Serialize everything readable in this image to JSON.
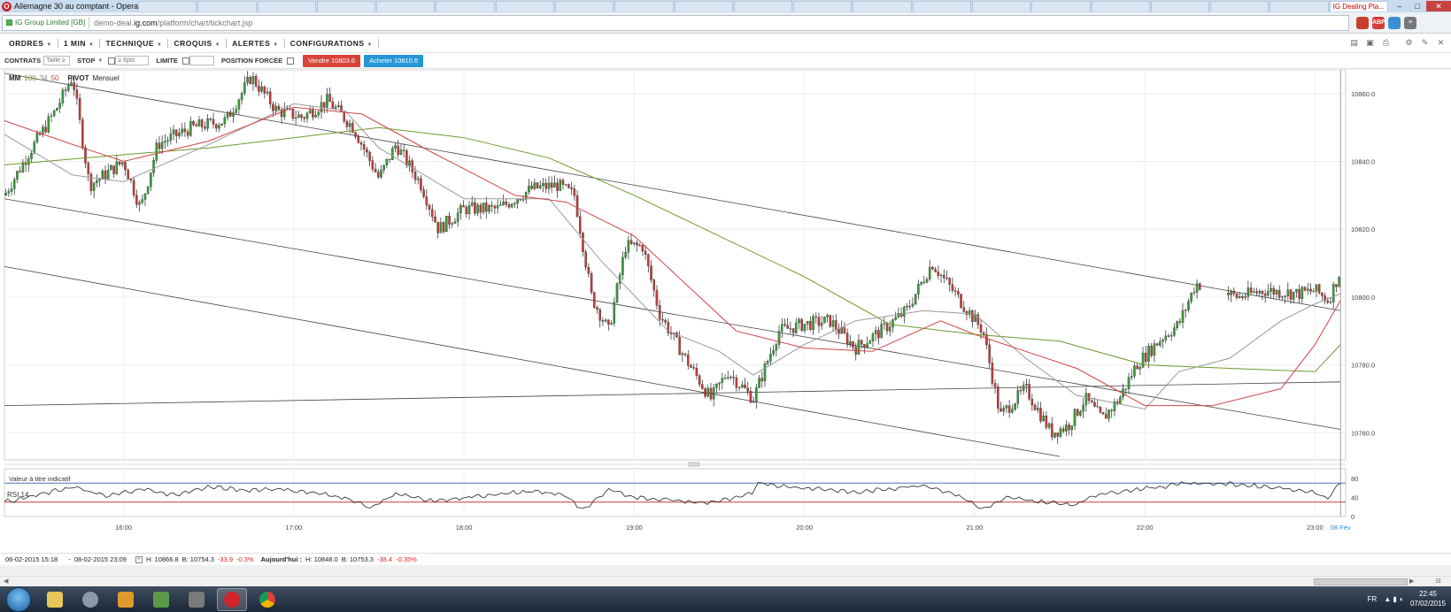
{
  "window": {
    "title": "Allemagne 30 au comptant - Opera",
    "tabs": [
      "",
      "",
      "",
      "",
      "",
      "",
      "",
      "",
      "",
      "",
      "",
      "",
      "",
      "",
      "",
      "",
      "",
      "",
      "",
      "",
      "IG Dealing Pla..."
    ],
    "controls": {
      "minimize": "–",
      "maximize": "□",
      "close": "✕"
    }
  },
  "address": {
    "security_label": "IG Group Limited [GB]",
    "url_prefix": "demo-deal.",
    "url_domain": "ig.com",
    "url_path": "/platform/chart/tickchart.jsp"
  },
  "menu": {
    "items": [
      "ORDRES",
      "1 MIN",
      "TECHNIQUE",
      "CROQUIS",
      "ALERTES",
      "CONFIGURATIONS"
    ]
  },
  "deal_bar": {
    "contracts_label": "CONTRATS",
    "size_placeholder": "Taille ≥ 1",
    "stop_label": "STOP",
    "stop_placeholder": "≥ 6pts",
    "limit_label": "LIMITE",
    "forced_label": "POSITION FORCÉE",
    "sell_label": "Vendre 10803.6",
    "buy_label": "Acheter 10810.6"
  },
  "legend": {
    "mm_label": "MM",
    "mm1": "100",
    "mm2": "34",
    "mm3": "50",
    "pivot_label": "PIVOT",
    "pivot_period": "Mensuel"
  },
  "disclaimer": "Valeur à titre indicatif",
  "rsi_label": "RSI  14",
  "chart_data": {
    "type": "candlestick",
    "title": "",
    "x_ticks": [
      "16:00",
      "17:00",
      "18:00",
      "19:00",
      "20:00",
      "21:00",
      "22:00",
      "23:00",
      "08 Fév"
    ],
    "x_range": [
      "15:18",
      "23:09"
    ],
    "price_ticks": [
      10860,
      10840,
      10820,
      10800,
      10780,
      10760
    ],
    "price_tick_labels": [
      "10860.0",
      "10840.0",
      "10820.0",
      "10800.0",
      "10780.0",
      "10760.0"
    ],
    "price_range": [
      10752,
      10867
    ],
    "rsi_ticks": [
      80,
      40,
      0
    ],
    "rsi_levels": {
      "upper": 70,
      "lower": 30
    },
    "rsi_range": [
      0,
      100
    ],
    "series": [
      {
        "name": "MM 100",
        "color": "#6d9a2c",
        "points": [
          [
            15.3,
            10839
          ],
          [
            16.0,
            10842
          ],
          [
            16.5,
            10844
          ],
          [
            17.0,
            10847
          ],
          [
            17.5,
            10850
          ],
          [
            18.0,
            10847
          ],
          [
            18.5,
            10841
          ],
          [
            19.0,
            10830
          ],
          [
            19.5,
            10818
          ],
          [
            20.0,
            10806
          ],
          [
            20.5,
            10792
          ],
          [
            21.0,
            10789
          ],
          [
            21.5,
            10787
          ],
          [
            22.0,
            10780
          ],
          [
            22.5,
            10779
          ],
          [
            23.0,
            10778
          ],
          [
            23.15,
            10786
          ]
        ]
      },
      {
        "name": "MM 34",
        "color": "#999999",
        "points": [
          [
            15.3,
            10848
          ],
          [
            15.7,
            10836
          ],
          [
            16.0,
            10834
          ],
          [
            16.5,
            10845
          ],
          [
            17.0,
            10857
          ],
          [
            17.3,
            10855
          ],
          [
            17.5,
            10844
          ],
          [
            18.0,
            10829
          ],
          [
            18.5,
            10829
          ],
          [
            18.8,
            10811
          ],
          [
            19.2,
            10790
          ],
          [
            19.5,
            10784
          ],
          [
            19.7,
            10777
          ],
          [
            20.0,
            10786
          ],
          [
            20.3,
            10793
          ],
          [
            20.7,
            10796
          ],
          [
            21.0,
            10795
          ],
          [
            21.3,
            10782
          ],
          [
            21.6,
            10771
          ],
          [
            22.0,
            10767
          ],
          [
            22.2,
            10778
          ],
          [
            22.5,
            10782
          ],
          [
            22.8,
            10793
          ],
          [
            23.0,
            10798
          ],
          [
            23.15,
            10801
          ]
        ]
      },
      {
        "name": "MM 50",
        "color": "#d04545",
        "points": [
          [
            15.3,
            10852
          ],
          [
            15.7,
            10845
          ],
          [
            16.0,
            10840
          ],
          [
            16.5,
            10846
          ],
          [
            17.0,
            10856
          ],
          [
            17.4,
            10854
          ],
          [
            17.8,
            10843
          ],
          [
            18.3,
            10830
          ],
          [
            18.6,
            10828
          ],
          [
            19.0,
            10818
          ],
          [
            19.3,
            10804
          ],
          [
            19.6,
            10790
          ],
          [
            20.0,
            10785
          ],
          [
            20.4,
            10784
          ],
          [
            20.8,
            10793
          ],
          [
            21.0,
            10789
          ],
          [
            21.3,
            10784
          ],
          [
            21.6,
            10779
          ],
          [
            22.0,
            10768
          ],
          [
            22.4,
            10768
          ],
          [
            22.8,
            10773
          ],
          [
            23.0,
            10786
          ],
          [
            23.15,
            10799
          ]
        ]
      }
    ],
    "trendlines": [
      {
        "from": [
          15.3,
          10866
        ],
        "to": [
          23.15,
          10796
        ]
      },
      {
        "from": [
          15.3,
          10829
        ],
        "to": [
          23.15,
          10761
        ]
      },
      {
        "from": [
          15.3,
          10809
        ],
        "to": [
          21.5,
          10753
        ]
      },
      {
        "from": [
          15.3,
          10768
        ],
        "to": [
          23.15,
          10775
        ]
      }
    ],
    "close_path": [
      [
        15.3,
        10830
      ],
      [
        15.45,
        10843
      ],
      [
        15.6,
        10855
      ],
      [
        15.7,
        10865
      ],
      [
        15.8,
        10833
      ],
      [
        16.0,
        10840
      ],
      [
        16.1,
        10826
      ],
      [
        16.2,
        10845
      ],
      [
        16.4,
        10850
      ],
      [
        16.6,
        10852
      ],
      [
        16.75,
        10865
      ],
      [
        16.9,
        10855
      ],
      [
        17.05,
        10853
      ],
      [
        17.2,
        10858
      ],
      [
        17.35,
        10850
      ],
      [
        17.5,
        10835
      ],
      [
        17.6,
        10845
      ],
      [
        17.75,
        10833
      ],
      [
        17.85,
        10820
      ],
      [
        18.0,
        10826
      ],
      [
        18.2,
        10826
      ],
      [
        18.4,
        10832
      ],
      [
        18.55,
        10833
      ],
      [
        18.65,
        10830
      ],
      [
        18.75,
        10800
      ],
      [
        18.85,
        10790
      ],
      [
        18.95,
        10815
      ],
      [
        19.05,
        10815
      ],
      [
        19.15,
        10795
      ],
      [
        19.3,
        10782
      ],
      [
        19.45,
        10770
      ],
      [
        19.55,
        10778
      ],
      [
        19.7,
        10770
      ],
      [
        19.85,
        10790
      ],
      [
        20.0,
        10792
      ],
      [
        20.15,
        10793
      ],
      [
        20.3,
        10785
      ],
      [
        20.45,
        10790
      ],
      [
        20.6,
        10796
      ],
      [
        20.75,
        10810
      ],
      [
        20.9,
        10800
      ],
      [
        21.05,
        10790
      ],
      [
        21.15,
        10765
      ],
      [
        21.3,
        10773
      ],
      [
        21.45,
        10760
      ],
      [
        21.55,
        10762
      ],
      [
        21.65,
        10770
      ],
      [
        21.75,
        10764
      ],
      [
        21.85,
        10770
      ],
      [
        21.95,
        10780
      ],
      [
        22.1,
        10788
      ],
      [
        22.2,
        10792
      ],
      [
        22.3,
        10804
      ],
      [
        22.55,
        10800
      ],
      [
        22.7,
        10802
      ],
      [
        22.9,
        10801
      ],
      [
        23.0,
        10802
      ],
      [
        23.08,
        10799
      ],
      [
        23.15,
        10808
      ]
    ],
    "rsi_path": [
      [
        15.3,
        30
      ],
      [
        15.5,
        45
      ],
      [
        15.7,
        62
      ],
      [
        15.9,
        42
      ],
      [
        16.1,
        58
      ],
      [
        16.3,
        45
      ],
      [
        16.5,
        62
      ],
      [
        16.7,
        55
      ],
      [
        16.9,
        58
      ],
      [
        17.1,
        50
      ],
      [
        17.3,
        40
      ],
      [
        17.45,
        18
      ],
      [
        17.6,
        48
      ],
      [
        17.8,
        32
      ],
      [
        18.0,
        38
      ],
      [
        18.2,
        48
      ],
      [
        18.4,
        52
      ],
      [
        18.6,
        45
      ],
      [
        18.7,
        12
      ],
      [
        18.85,
        58
      ],
      [
        19.0,
        40
      ],
      [
        19.2,
        35
      ],
      [
        19.4,
        28
      ],
      [
        19.6,
        38
      ],
      [
        19.7,
        50
      ],
      [
        19.72,
        72
      ],
      [
        19.9,
        62
      ],
      [
        20.1,
        58
      ],
      [
        20.3,
        50
      ],
      [
        20.5,
        58
      ],
      [
        20.7,
        66
      ],
      [
        20.9,
        45
      ],
      [
        21.05,
        15
      ],
      [
        21.2,
        40
      ],
      [
        21.4,
        30
      ],
      [
        21.6,
        25
      ],
      [
        21.7,
        45
      ],
      [
        21.9,
        55
      ],
      [
        22.1,
        62
      ],
      [
        22.2,
        70
      ],
      [
        22.5,
        68
      ],
      [
        22.8,
        60
      ],
      [
        23.0,
        50
      ],
      [
        23.08,
        38
      ],
      [
        23.15,
        72
      ]
    ]
  },
  "status": {
    "from_date": "06-02-2015 15:18",
    "to_date": "08-02-2015 23:09",
    "high_label": "H: 10866.8",
    "low_label": "B: 10754.3",
    "change": "-33.9",
    "change_pct": "-0.3%",
    "today_label": "Aujourd'hui :",
    "today_high": "H: 10848.0",
    "today_low": "B: 10753.3",
    "today_change": "-38.4",
    "today_change_pct": "-0.35%"
  },
  "taskbar": {
    "lang": "FR",
    "time": "22:45",
    "date": "07/02/2015"
  }
}
